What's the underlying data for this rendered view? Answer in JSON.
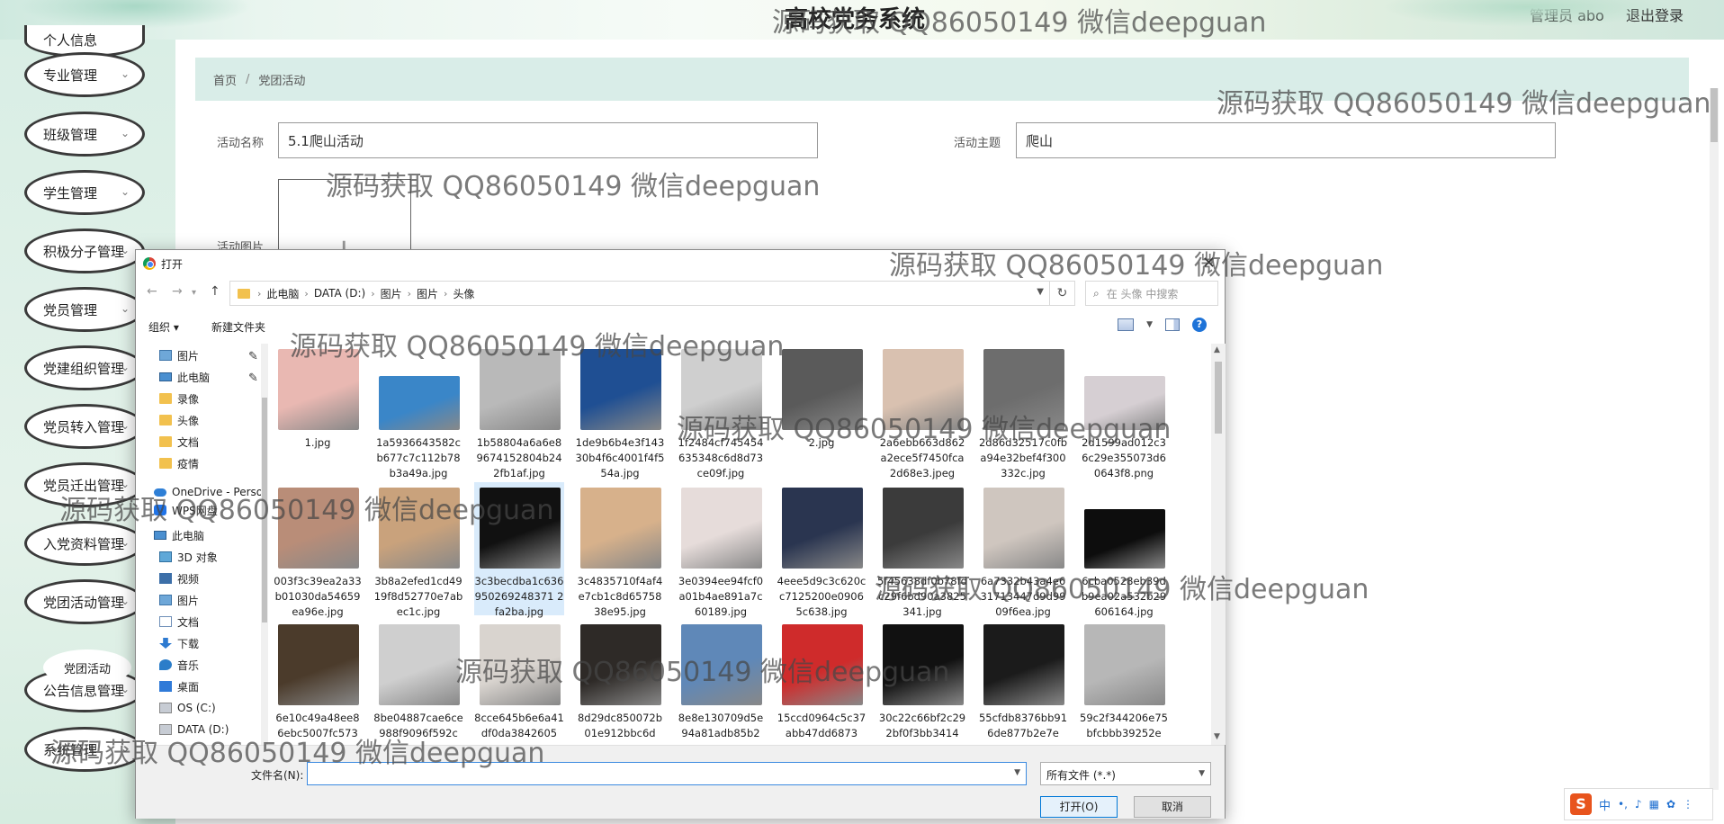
{
  "header": {
    "title": "高校党务系统",
    "admin": "管理员 abo",
    "logout": "退出登录"
  },
  "sidebar": {
    "partial_label": "个人信息",
    "items": [
      "专业管理",
      "班级管理",
      "学生管理",
      "积极分子管理",
      "党员管理",
      "党建组织管理",
      "党员转入管理",
      "党员迁出管理",
      "入党资料管理",
      "党团活动管理",
      "公告信息管理",
      "系统管理"
    ],
    "submenu": "党团活动"
  },
  "breadcrumb": {
    "home": "首页",
    "sep": "/",
    "current": "党团活动"
  },
  "form": {
    "activity_name_label": "活动名称",
    "activity_name": "5.1爬山活动",
    "theme_label": "活动主题",
    "theme": "爬山",
    "image_label": "活动图片",
    "plus": "+"
  },
  "dialog": {
    "title": "打开",
    "path": [
      "此电脑",
      "DATA (D:)",
      "图片",
      "图片",
      "头像"
    ],
    "search_placeholder": "在 头像 中搜索",
    "organize": "组织 ▾",
    "new_folder": "新建文件夹",
    "nav": [
      {
        "label": "图片",
        "icon": "img",
        "pin": true
      },
      {
        "label": "此电脑",
        "icon": "pc",
        "pin": true
      },
      {
        "label": "录像",
        "icon": "folder"
      },
      {
        "label": "头像",
        "icon": "folder"
      },
      {
        "label": "文档",
        "icon": "folder"
      },
      {
        "label": "疫情",
        "icon": "folder"
      },
      {
        "label": "OneDrive - Perso",
        "icon": "cloud"
      },
      {
        "label": "WPS网盘",
        "icon": "wps"
      },
      {
        "label": "此电脑",
        "icon": "pc"
      },
      {
        "label": "3D 对象",
        "icon": "obj"
      },
      {
        "label": "视频",
        "icon": "video"
      },
      {
        "label": "图片",
        "icon": "img"
      },
      {
        "label": "文档",
        "icon": "doc"
      },
      {
        "label": "下载",
        "icon": "down"
      },
      {
        "label": "音乐",
        "icon": "music"
      },
      {
        "label": "桌面",
        "icon": "desk"
      },
      {
        "label": "OS (C:)",
        "icon": "drive"
      },
      {
        "label": "DATA (D:)",
        "icon": "drive"
      }
    ],
    "files": [
      {
        "name": "1.jpg",
        "color": "#e9b8b2"
      },
      {
        "name": "1a5936643582cb677c7c112b78b3a49a.jpg",
        "color": "#3a86c8"
      },
      {
        "name": "1b58804a6a6e89674152804b242fb1af.jpg",
        "color": "#b9b9b9"
      },
      {
        "name": "1de9b6b4e3f14330b4f6c4001f4f554a.jpg",
        "color": "#1f4f93"
      },
      {
        "name": "1f2484cf745454635348c6d8d73ce09f.jpg",
        "color": "#cfcfcf"
      },
      {
        "name": "2.jpg",
        "color": "#5a5a5a"
      },
      {
        "name": "2a6ebb663d862a2ece5f7450fca2d68e3.jpeg",
        "color": "#d9c1b0"
      },
      {
        "name": "2d86d32517c0fba94e32bef4f300332c.jpg",
        "color": "#6d6d6d"
      },
      {
        "name": "2d1599ad012c36c29e355073d60643f8.png",
        "color": "#d6cfd3"
      },
      {
        "name": "003f3c39ea2a33b01030da54659ea96e.jpg",
        "color": "#b98d78"
      },
      {
        "name": "3b8a2efed1cd4919f8d52770e7abec1c.jpg",
        "color": "#c9a27c"
      },
      {
        "name": "3c3becdba1c636950269248371 2fa2ba.jpg",
        "color": "#111111"
      },
      {
        "name": "3c4835710f4af4e7cb1c8d6575838e95.jpg",
        "color": "#d7b18b"
      },
      {
        "name": "3e0394ee94fcf0a01b4ae891a7c60189.jpg",
        "color": "#e6dcda"
      },
      {
        "name": "4eee5d9c3c620cc7125200e09065c638.jpg",
        "color": "#2a3550"
      },
      {
        "name": "5f45638df0b78fdc29f6bd90a3825341.jpg",
        "color": "#3b3b3b"
      },
      {
        "name": "6a7332b43a4e631713447d9d9909f6ea.jpg",
        "color": "#cfc6bf"
      },
      {
        "name": "6cba0528eb39db9ea02a532b29606164.jpg",
        "color": "#0d0d0d"
      },
      {
        "name": "6e10c49a48ee86ebc5007fc573",
        "color": "#4b3b2b"
      },
      {
        "name": "8be04887cae6ce988f9096f592c",
        "color": "#cfcfcf"
      },
      {
        "name": "8cce645b6e6a41df0da3842605",
        "color": "#d9d4cf"
      },
      {
        "name": "8d29dc850072b01e912bbc6d",
        "color": "#2e2a27"
      },
      {
        "name": "8e8e130709d5e94a81adb85b2",
        "color": "#5f88b8"
      },
      {
        "name": "15ccd0964c5c37abb47dd6873",
        "color": "#cf2b2b"
      },
      {
        "name": "30c22c66bf2c292bf0f3bb3414",
        "color": "#111111"
      },
      {
        "name": "55cfdb8376bb916de877b2e7e",
        "color": "#1b1b1b"
      },
      {
        "name": "59c2f344206e75bfcbbb39252e",
        "color": "#b7b7b7"
      }
    ],
    "filename_label": "文件名(N):",
    "filetype": "所有文件 (*.*)",
    "open": "打开(O)",
    "cancel": "取消"
  },
  "watermark": "源码获取 QQ86050149 微信deepguan",
  "ime": {
    "logo": "S",
    "text": "中"
  }
}
